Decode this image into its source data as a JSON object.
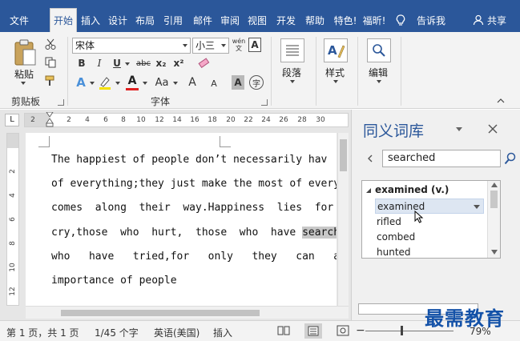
{
  "menu": {
    "tabs": [
      "文件",
      "开始",
      "插入",
      "设计",
      "布局",
      "引用",
      "邮件",
      "审阅",
      "视图",
      "开发",
      "帮助",
      "特色!",
      "福昕!"
    ],
    "active_tab": "开始",
    "tell_me": "告诉我",
    "share": "共享"
  },
  "ribbon": {
    "clipboard": {
      "paste_label": "粘贴",
      "group_label": "剪贴板"
    },
    "font": {
      "font_name": "宋体",
      "font_size": "小三",
      "wen_label": "wén\n文",
      "bold": "B",
      "italic": "I",
      "underline": "U",
      "strike": "abc",
      "subscript": "x₂",
      "superscript": "x²",
      "text_effect": "A",
      "font_color": "A",
      "change_case": "Aa",
      "grow": "A",
      "shrink": "A",
      "shade": "A",
      "enclose": "字",
      "group_label": "字体"
    },
    "paragraph": {
      "label": "段落"
    },
    "styles": {
      "label": "样式"
    },
    "editing": {
      "label": "编辑"
    }
  },
  "ruler": {
    "corner": "L",
    "h_ticks": [
      "2",
      "2",
      "4",
      "6",
      "8",
      "10",
      "12",
      "14",
      "16",
      "18",
      "20",
      "22",
      "24",
      "26",
      "28",
      "30"
    ],
    "v_ticks": [
      "2",
      "4",
      "6",
      "8",
      "10",
      "12"
    ]
  },
  "document": {
    "lines": [
      {
        "text": "The happiest of people don’t necessarily hav"
      },
      {
        "text": "of everything;they just make the most of every"
      },
      {
        "text": "comes  along  their  way.Happiness  lies  for"
      },
      {
        "before": "cry,those  who  hurt,  those  who  have ",
        "highlight": "searched",
        "after": ""
      },
      {
        "text": "who   have   tried,for   only   they   can   appre"
      },
      {
        "text": "importance of people"
      }
    ]
  },
  "thesaurus": {
    "title": "同义词库",
    "search_value": "searched",
    "heading": "examined (v.)",
    "items": [
      "examined",
      "rifled",
      "combed",
      "hunted"
    ],
    "selected_index": 0
  },
  "status": {
    "page": "第 1 页，共 1 页",
    "words": "1/45 个字",
    "language": "英语(美国)",
    "mode": "插入",
    "zoom": "79%"
  },
  "watermark": "最需教育",
  "colors": {
    "brand": "#2b579a",
    "highlight": "#c8c8c8",
    "font_color_bar": "#e02020",
    "highlight_bar": "#f5e000"
  }
}
